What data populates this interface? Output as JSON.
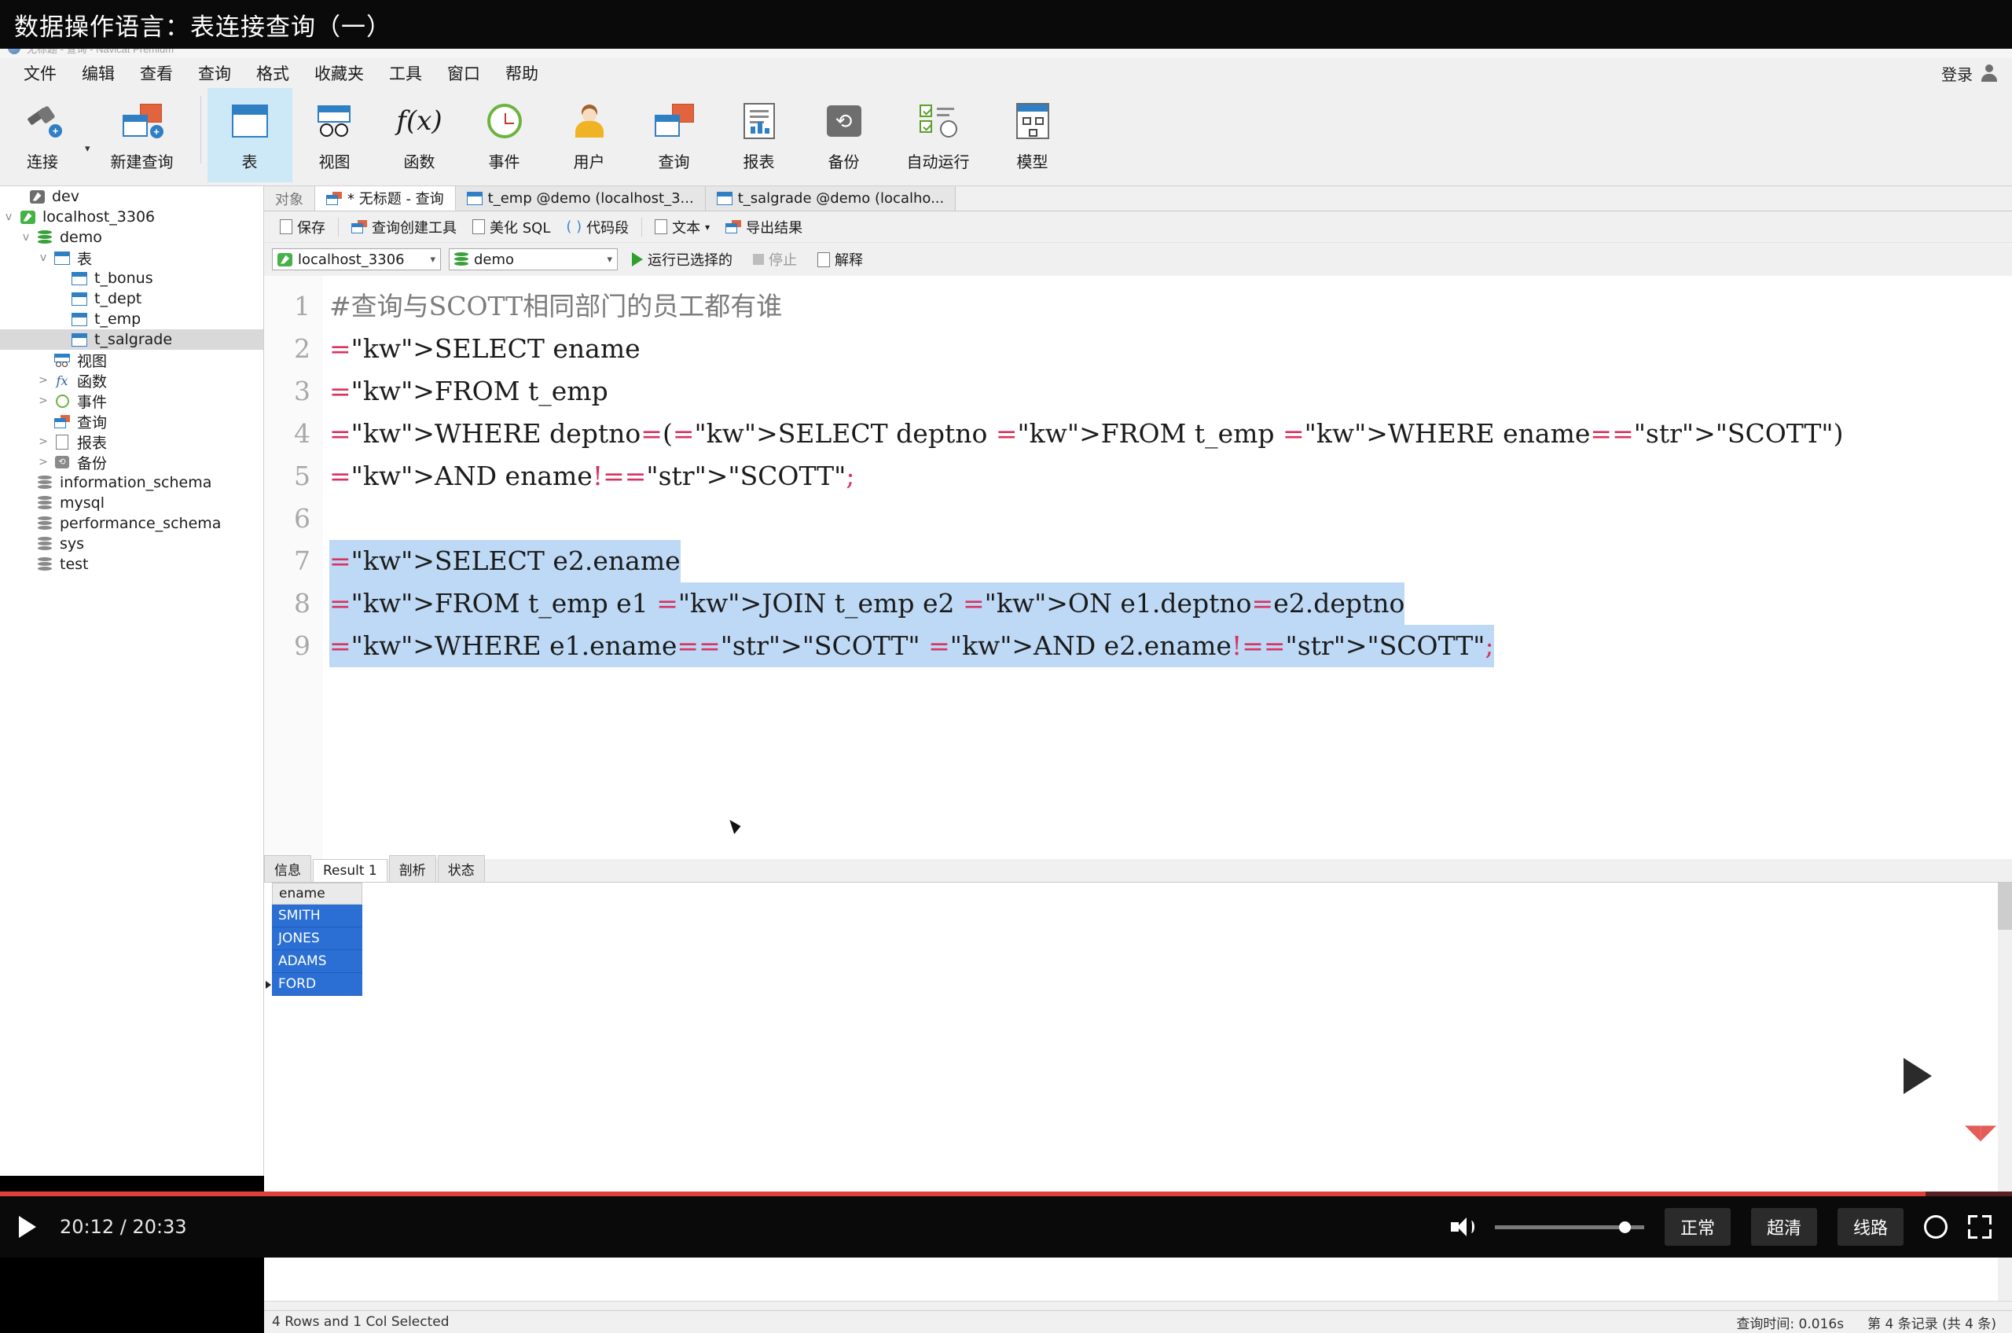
{
  "video": {
    "title": "数据操作语言：表连接查询（一）",
    "current_time": "20:12",
    "total_time": "20:33",
    "time_display": "20:12 / 20:33",
    "quality_chips": [
      "正常",
      "超清",
      "线路"
    ],
    "accent_color": "#e0403a"
  },
  "app": {
    "titlebar": "无标题 - 查询  -  Navicat Premium",
    "login_label": "登录",
    "menu": [
      "文件",
      "编辑",
      "查看",
      "查询",
      "格式",
      "收藏夹",
      "工具",
      "窗口",
      "帮助"
    ],
    "toolbar": [
      {
        "label": "连接",
        "icon": "plug-add-icon",
        "has_dropdown": true,
        "selected": false
      },
      {
        "label": "新建查询",
        "icon": "new-query-icon",
        "has_dropdown": false,
        "selected": false
      },
      {
        "label": "表",
        "icon": "table-icon",
        "has_dropdown": false,
        "selected": true
      },
      {
        "label": "视图",
        "icon": "view-icon",
        "has_dropdown": false,
        "selected": false
      },
      {
        "label": "函数",
        "icon": "function-fx-icon",
        "has_dropdown": false,
        "selected": false
      },
      {
        "label": "事件",
        "icon": "clock-event-icon",
        "has_dropdown": false,
        "selected": false
      },
      {
        "label": "用户",
        "icon": "user-icon",
        "has_dropdown": false,
        "selected": false
      },
      {
        "label": "查询",
        "icon": "query-icon",
        "has_dropdown": false,
        "selected": false
      },
      {
        "label": "报表",
        "icon": "report-icon",
        "has_dropdown": false,
        "selected": false
      },
      {
        "label": "备份",
        "icon": "backup-icon",
        "has_dropdown": false,
        "selected": false
      },
      {
        "label": "自动运行",
        "icon": "automation-icon",
        "has_dropdown": false,
        "selected": false
      },
      {
        "label": "模型",
        "icon": "model-icon",
        "has_dropdown": false,
        "selected": false
      }
    ]
  },
  "sidebar": {
    "items": [
      {
        "label": "dev",
        "icon": "dolphin-gray-icon",
        "indent": 1,
        "twisty": "",
        "selected": false
      },
      {
        "label": "localhost_3306",
        "icon": "dolphin-green-icon",
        "indent": 0,
        "twisty": "v",
        "selected": false
      },
      {
        "label": "demo",
        "icon": "database-green-icon",
        "indent": 1,
        "twisty": "v",
        "selected": false
      },
      {
        "label": "表",
        "icon": "table-icon",
        "indent": 2,
        "twisty": "v",
        "selected": false
      },
      {
        "label": "t_bonus",
        "icon": "table-icon",
        "indent": 4,
        "twisty": "",
        "selected": false
      },
      {
        "label": "t_dept",
        "icon": "table-icon",
        "indent": 4,
        "twisty": "",
        "selected": false
      },
      {
        "label": "t_emp",
        "icon": "table-icon",
        "indent": 4,
        "twisty": "",
        "selected": false
      },
      {
        "label": "t_salgrade",
        "icon": "table-icon",
        "indent": 4,
        "twisty": "",
        "selected": true
      },
      {
        "label": "视图",
        "icon": "view-icon",
        "indent": 3,
        "twisty": "",
        "selected": false
      },
      {
        "label": "函数",
        "icon": "function-fx-icon",
        "indent": 2,
        "twisty": ">",
        "selected": false
      },
      {
        "label": "事件",
        "icon": "clock-event-icon",
        "indent": 2,
        "twisty": ">",
        "selected": false
      },
      {
        "label": "查询",
        "icon": "query-icon",
        "indent": 3,
        "twisty": "",
        "selected": false
      },
      {
        "label": "报表",
        "icon": "report-icon",
        "indent": 2,
        "twisty": ">",
        "selected": false
      },
      {
        "label": "备份",
        "icon": "backup-icon",
        "indent": 2,
        "twisty": ">",
        "selected": false
      },
      {
        "label": "information_schema",
        "icon": "database-gray-icon",
        "indent": 1,
        "twisty": "",
        "selected": false
      },
      {
        "label": "mysql",
        "icon": "database-gray-icon",
        "indent": 1,
        "twisty": "",
        "selected": false
      },
      {
        "label": "performance_schema",
        "icon": "database-gray-icon",
        "indent": 1,
        "twisty": "",
        "selected": false
      },
      {
        "label": "sys",
        "icon": "database-gray-icon",
        "indent": 1,
        "twisty": "",
        "selected": false
      },
      {
        "label": "test",
        "icon": "database-gray-icon",
        "indent": 1,
        "twisty": "",
        "selected": false
      }
    ]
  },
  "tabs": [
    {
      "label": "对象",
      "icon": "",
      "state": "inactive"
    },
    {
      "label": "* 无标题 - 查询",
      "icon": "query-icon",
      "state": "active"
    },
    {
      "label": "t_emp @demo (localhost_3...",
      "icon": "table-icon",
      "state": "normal"
    },
    {
      "label": "t_salgrade @demo (localho...",
      "icon": "table-icon",
      "state": "normal"
    }
  ],
  "query_toolbar": {
    "save": "保存",
    "query_builder": "查询创建工具",
    "beautify_sql": "美化 SQL",
    "snippet_paren": "( )",
    "snippet": "代码段",
    "text": "文本",
    "export_result": "导出结果"
  },
  "conn_bar": {
    "connection": "localhost_3306",
    "database": "demo",
    "run_selected": "运行已选择的",
    "stop": "停止",
    "explain": "解释"
  },
  "editor": {
    "line_numbers": [
      "1",
      "2",
      "3",
      "4",
      "5",
      "6",
      "7",
      "8",
      "9"
    ],
    "lines": [
      "#查询与SCOTT相同部门的员工都有谁",
      "SELECT ename",
      "FROM t_emp",
      "WHERE deptno=(SELECT deptno FROM t_emp WHERE ename=\"SCOTT\")",
      "AND ename!=\"SCOTT\";",
      "",
      "SELECT e2.ename",
      "FROM t_emp e1 JOIN t_emp e2 ON e1.deptno=e2.deptno",
      "WHERE e1.ename=\"SCOTT\" AND e2.ename!=\"SCOTT\";"
    ],
    "selected_lines": [
      7,
      8,
      9
    ]
  },
  "result_tabs": [
    {
      "label": "信息",
      "active": false
    },
    {
      "label": "Result 1",
      "active": true
    },
    {
      "label": "剖析",
      "active": false
    },
    {
      "label": "状态",
      "active": false
    }
  ],
  "result_grid": {
    "columns": [
      "ename"
    ],
    "rows": [
      [
        "SMITH"
      ],
      [
        "JONES"
      ],
      [
        "ADAMS"
      ],
      [
        "FORD"
      ]
    ],
    "current_row_index": 3
  },
  "grid_footer_icons": [
    "add-row-icon",
    "remove-row-icon",
    "apply-icon",
    "cancel-icon",
    "refresh-icon",
    "stop-icon"
  ],
  "status_bar": {
    "selection": "4 Rows and 1 Col Selected",
    "query_time": "查询时间: 0.016s",
    "record_info": "第 4 条记录 (共 4 条)"
  }
}
